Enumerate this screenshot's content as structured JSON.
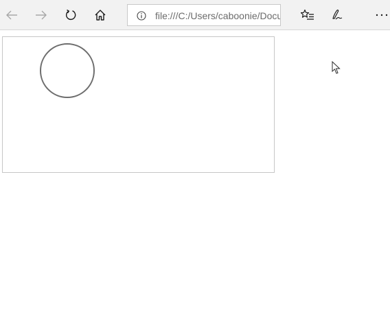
{
  "browser": {
    "address_bar": {
      "url": "file:///C:/Users/caboonie/Documents/"
    },
    "icons": {
      "back": "back-arrow-icon",
      "forward": "forward-arrow-icon",
      "refresh": "refresh-icon",
      "home": "home-icon",
      "site_info": "info-icon",
      "favorites": "favorites-list-icon",
      "notes": "pen-icon",
      "more": "more-icon"
    }
  },
  "page": {
    "shapes": [
      {
        "type": "circle",
        "stroke": "#6d6d6d",
        "fill": "none"
      }
    ],
    "canvas_border": "#c6c6c6"
  }
}
